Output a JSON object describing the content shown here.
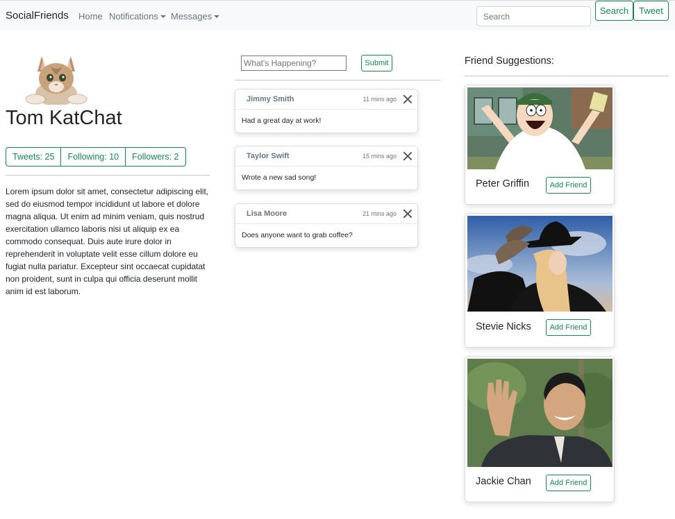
{
  "navbar": {
    "brand": "SocialFriends",
    "links": [
      {
        "label": "Home"
      },
      {
        "label": "Notifications"
      },
      {
        "label": "Messages"
      }
    ],
    "search_placeholder": "Search",
    "search_button": "Search",
    "tweet_button": "Tweet",
    "accent_color": "#198754"
  },
  "profile": {
    "name": "Tom KatChat",
    "avatar_icon": "cat-avatar-icon",
    "stats": [
      "Tweets: 25",
      "Following: 10",
      "Followers: 2"
    ],
    "bio": "Lorem ipsum dolor sit amet, consectetur adipiscing elit, sed do eiusmod tempor incididunt ut labore et dolore magna aliqua. Ut enim ad minim veniam, quis nostrud exercitation ullamco laboris nisi ut aliquip ex ea commodo consequat. Duis aute irure dolor in reprehenderit in voluptate velit esse cillum dolore eu fugiat nulla pariatur. Excepteur sint occaecat cupidatat non proident, sunt in culpa qui officia deserunt mollit anim id est laborum."
  },
  "feed": {
    "compose_placeholder": "What's Happening?",
    "submit_button": "Submit",
    "posts": [
      {
        "author": "Jimmy Smith",
        "time": "11 mins ago",
        "text": "Had a great day at work!"
      },
      {
        "author": "Taylor Swift",
        "time": "15 mins ago",
        "text": "Wrote a new sad song!"
      },
      {
        "author": "Lisa Moore",
        "time": "21 mins ago",
        "text": "Does anyone want to grab coffee?"
      }
    ]
  },
  "suggestions": {
    "title": "Friend Suggestions:",
    "add_label": "Add Friend",
    "friends": [
      {
        "name": "Peter Griffin",
        "photo_icon": "cartoon-character-photo"
      },
      {
        "name": "Stevie Nicks",
        "photo_icon": "woman-in-hat-photo"
      },
      {
        "name": "Jackie Chan",
        "photo_icon": "man-waving-photo"
      }
    ]
  }
}
